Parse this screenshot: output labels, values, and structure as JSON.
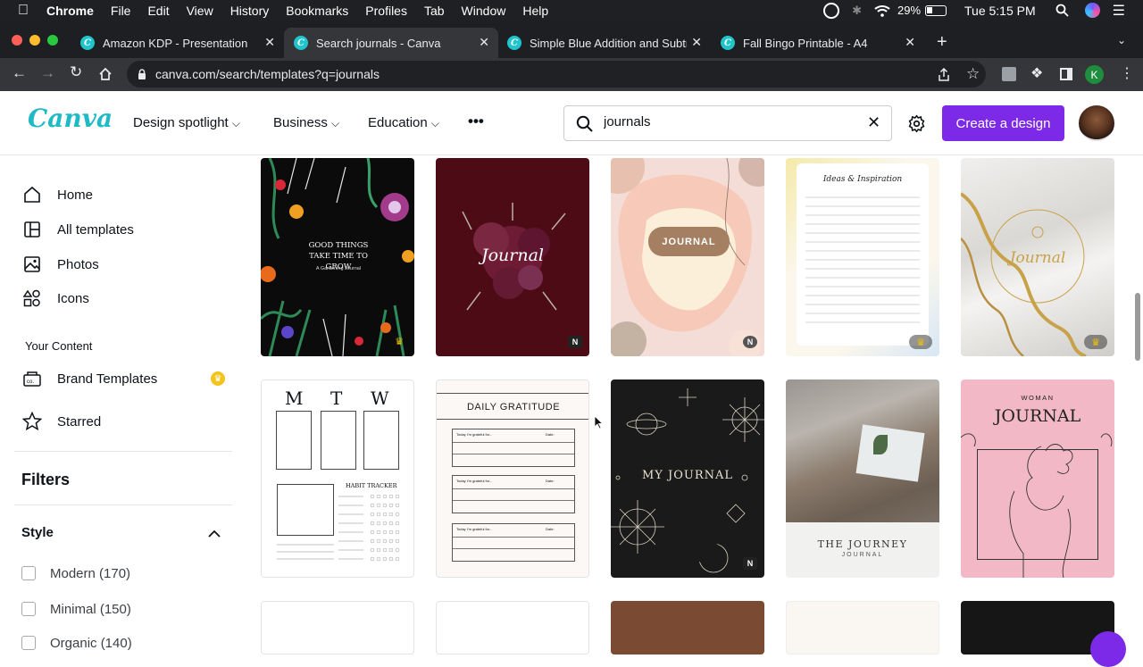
{
  "menubar": {
    "app": "Chrome",
    "items": [
      "File",
      "Edit",
      "View",
      "History",
      "Bookmarks",
      "Profiles",
      "Tab",
      "Window",
      "Help"
    ],
    "battery": "29%",
    "clock": "Tue 5:15 PM"
  },
  "tabs": [
    {
      "title": "Amazon KDP - Presentation",
      "active": false
    },
    {
      "title": "Search journals - Canva",
      "active": true
    },
    {
      "title": "Simple Blue Addition and Subtr",
      "active": false
    },
    {
      "title": "Fall Bingo Printable - A4",
      "active": false
    }
  ],
  "browser": {
    "url": "canva.com/search/templates?q=journals",
    "profile_initial": "K"
  },
  "canva": {
    "logo": "Canva",
    "nav": [
      "Design spotlight",
      "Business",
      "Education"
    ],
    "more": "•••",
    "search_value": "journals",
    "create_label": "Create a design"
  },
  "sidebar": {
    "items": [
      {
        "label": "Home",
        "icon": "home-icon"
      },
      {
        "label": "All templates",
        "icon": "templates-icon"
      },
      {
        "label": "Photos",
        "icon": "photo-icon"
      },
      {
        "label": "Icons",
        "icon": "shapes-icon"
      }
    ],
    "your_content": "Your Content",
    "content_items": [
      {
        "label": "Brand Templates",
        "icon": "brand-templates-icon"
      },
      {
        "label": "Starred",
        "icon": "star-icon"
      }
    ],
    "filters_title": "Filters",
    "style_title": "Style",
    "style_options": [
      "Modern (170)",
      "Minimal (150)",
      "Organic (140)"
    ]
  },
  "templates": {
    "t1_title": "GOOD THINGS TAKE TIME TO GROW",
    "t1_sub": "A Gardening Journal",
    "t2_title": "Journal",
    "t3_title": "JOURNAL",
    "t4_title": "Ideas & Inspiration",
    "t5_title": "Journal",
    "t6_letters": [
      "M",
      "T",
      "W"
    ],
    "t6_habit": "HABIT TRACKER",
    "t7_title": "DAILY GRATITUDE",
    "t7_row_label": "Today I'm grateful for...",
    "t7_date": "Date:",
    "t8_title": "MY JOURNAL",
    "t9_title": "THE JOURNEY",
    "t9_sub": "JOURNAL",
    "t10_pre": "WOMAN",
    "t10_title": "JOURNAL",
    "badge_new": "N",
    "crown": "♛"
  },
  "colors": {
    "accent": "#7d2ae8",
    "logo": "#20b9c6"
  }
}
